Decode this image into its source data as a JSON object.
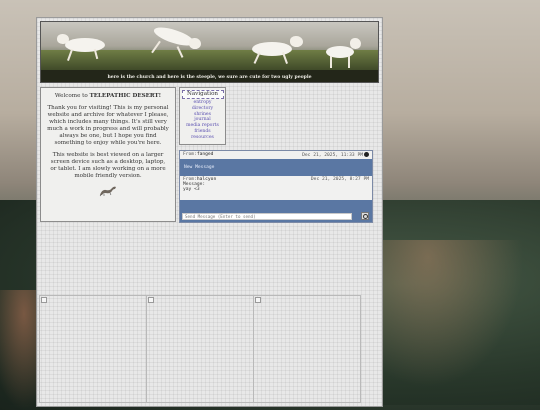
{
  "banner": {
    "caption": "here is the church and here is the steeple, we sure are cute for two ugly people"
  },
  "welcome": {
    "intro": "Welcome to ",
    "site_name": "TELEPATHIC DESERT!",
    "paragraph1": "Thank you for visiting! This is my personal website and archive for whatever I please, which includes many things. It's still very much a work in progress and will probably always be one, but I hope you find something to enjoy while you're here.",
    "paragraph2": "This website is best viewed on a larger screen device such as a desktop, laptop, or tablet. I am slowly working on a more mobile friendly version."
  },
  "nav": {
    "title": "Navigation",
    "links": [
      "entropy",
      "directory",
      "shrines",
      "journal",
      "media reports",
      "friends",
      "resources"
    ]
  },
  "chat": {
    "messages": [
      {
        "from_label": "From:",
        "from": "fanged",
        "time": "Dec 21, 2025, 11:33 PM",
        "text": ""
      },
      {
        "from_label": "From:",
        "from": "halcyon",
        "time": "Dec 21, 2025, 8:27 PM",
        "message_label": "Message:",
        "text": "yay <3"
      }
    ],
    "new_message": "New Message",
    "input_placeholder": "Send Message (Enter to send)",
    "colors": {
      "panel": "#5a77a3",
      "link": "#5a4fb0"
    }
  }
}
